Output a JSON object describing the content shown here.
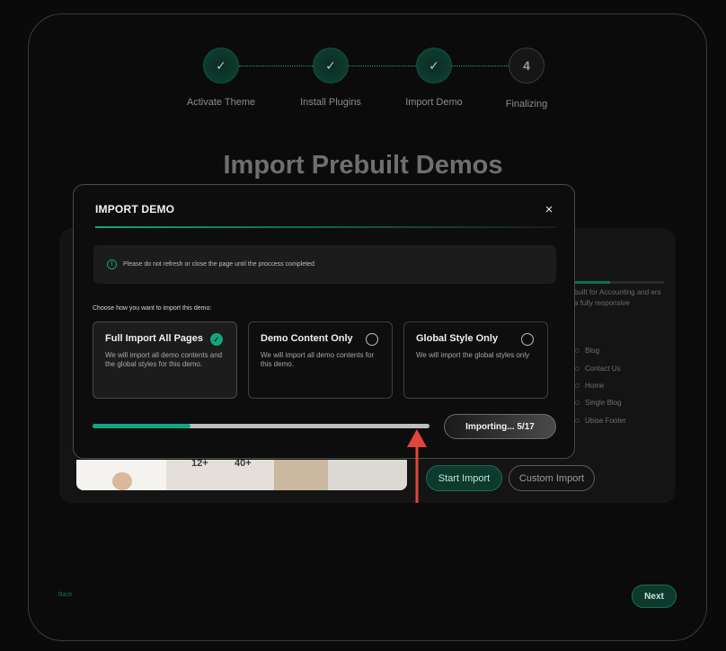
{
  "stepper": {
    "steps": [
      {
        "label": "Activate Theme",
        "state": "done",
        "mark": "✓"
      },
      {
        "label": "Install Plugins",
        "state": "done",
        "mark": "✓"
      },
      {
        "label": "Import Demo",
        "state": "done",
        "mark": "✓"
      },
      {
        "label": "Finalizing",
        "state": "todo",
        "mark": "4"
      }
    ]
  },
  "background": {
    "title": "Import Prebuilt Demos",
    "preview_stats": [
      "12+",
      "40+"
    ],
    "list": [
      "Blog",
      "Contact Us",
      "Home",
      "Single Blog",
      "Ubise Footer"
    ],
    "description": "built for Accounting and ers a fully responsive",
    "start_import_label": "Start Import",
    "custom_import_label": "Custom Import",
    "back_label": "Back",
    "next_label": "Next"
  },
  "modal": {
    "title": "IMPORT DEMO",
    "close_icon": "×",
    "notice": "Please do not refresh or close the page until the proccess completed",
    "choose_label": "Choose how you want to import this demo:",
    "options": [
      {
        "title": "Full Import All Pages",
        "desc": "We will import all demo contents and the global styles for this demo.",
        "selected": true
      },
      {
        "title": "Demo Content Only",
        "desc": "We will import all demo contents for this demo.",
        "selected": false
      },
      {
        "title": "Global Style Only",
        "desc": "We will import the global styles only",
        "selected": false
      }
    ],
    "progress_percent": 29,
    "importing_label": "Importing... 5/17"
  },
  "colors": {
    "accent": "#13a57f",
    "annotation_arrow": "#e2463a"
  }
}
